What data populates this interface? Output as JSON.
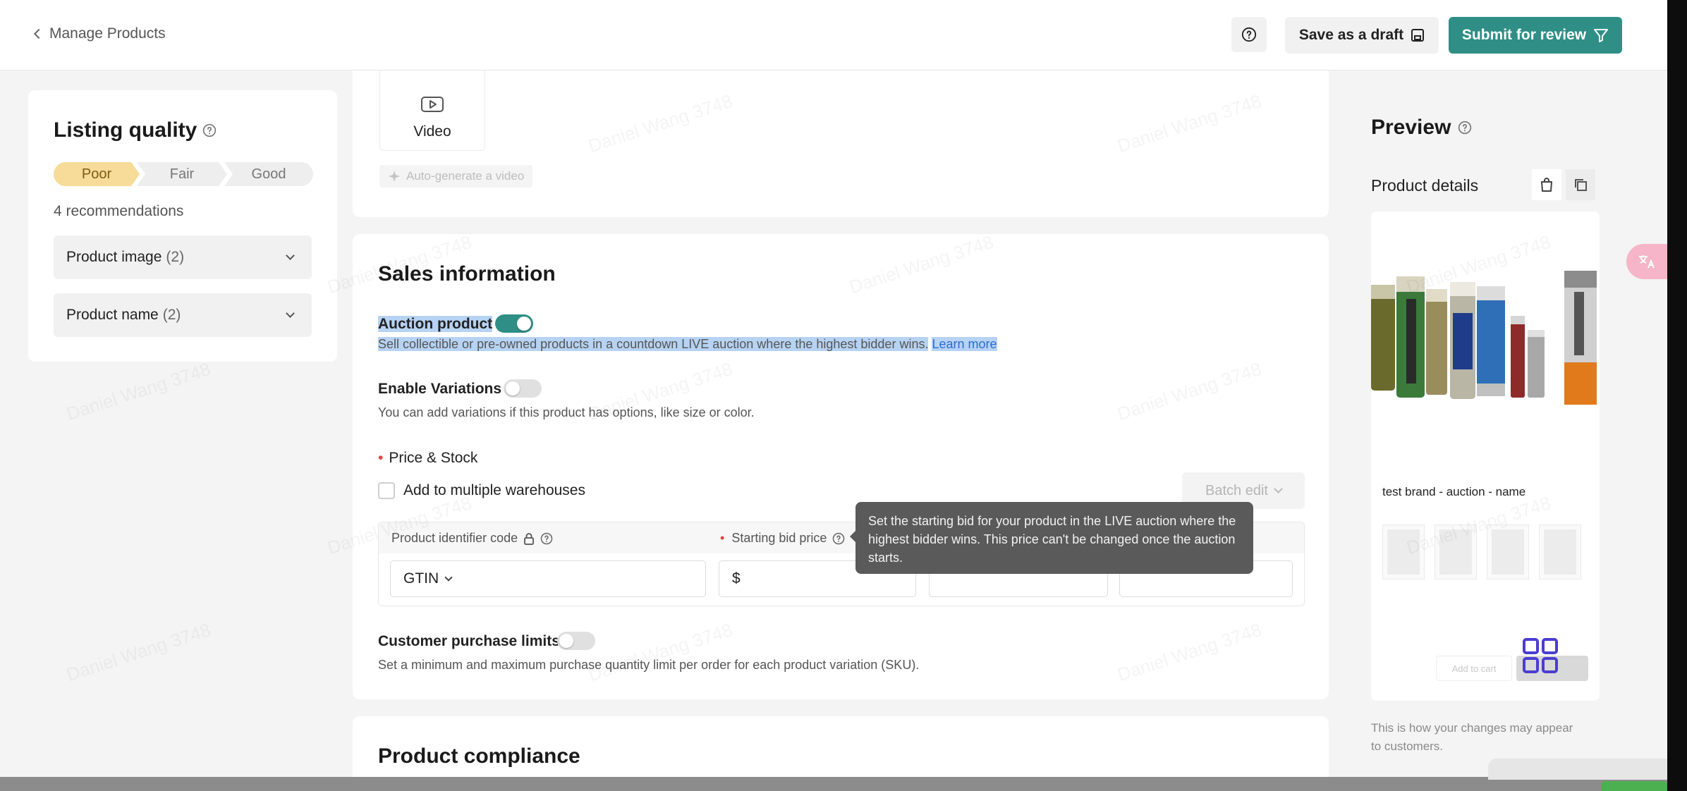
{
  "header": {
    "back_label": "Manage Products",
    "save_draft_label": "Save as a draft",
    "submit_label": "Submit for review"
  },
  "listing_quality": {
    "title": "Listing quality",
    "steps": [
      "Poor",
      "Fair",
      "Good"
    ],
    "active_step": "Poor",
    "recommendations_label": "4 recommendations",
    "items": [
      {
        "label": "Product image",
        "count": "(2)"
      },
      {
        "label": "Product name",
        "count": "(2)"
      }
    ]
  },
  "media": {
    "video_label": "Video",
    "autogen_label": "Auto-generate a video"
  },
  "sales": {
    "title": "Sales information",
    "auction": {
      "label": "Auction product",
      "enabled": true,
      "description": "Sell collectible or pre-owned products in a countdown LIVE auction where the highest bidder wins.",
      "learn_more": "Learn more"
    },
    "variations": {
      "label": "Enable Variations",
      "enabled": false,
      "description": "You can add variations if this product has options, like size or color."
    },
    "price_stock": {
      "label": "Price & Stock",
      "warehouses_label": "Add to multiple warehouses",
      "warehouses_checked": false,
      "batch_edit_label": "Batch edit",
      "columns": {
        "identifier": "Product identifier code",
        "starting_bid": "Starting bid price"
      },
      "identifier_value": "GTIN",
      "currency_symbol": "$"
    },
    "tooltip": "Set the starting bid for your product in the LIVE auction where the highest bidder wins. This price can't be changed once the auction starts.",
    "purchase_limits": {
      "label": "Customer purchase limits",
      "enabled": false,
      "description": "Set a minimum and maximum purchase quantity limit per order for each product variation (SKU)."
    }
  },
  "compliance": {
    "title": "Product compliance"
  },
  "preview": {
    "title": "Preview",
    "product_details_label": "Product details",
    "product_name": "test brand - auction - name",
    "add_to_cart": "Add to cart",
    "note": "This is how your changes may appear to customers."
  },
  "watermark_text": "Daniel Wang 3748",
  "colors": {
    "accent": "#2f8f86",
    "poor": "#f6dc98",
    "highlight": "#b7d3f3",
    "link": "#2b6cd0"
  }
}
